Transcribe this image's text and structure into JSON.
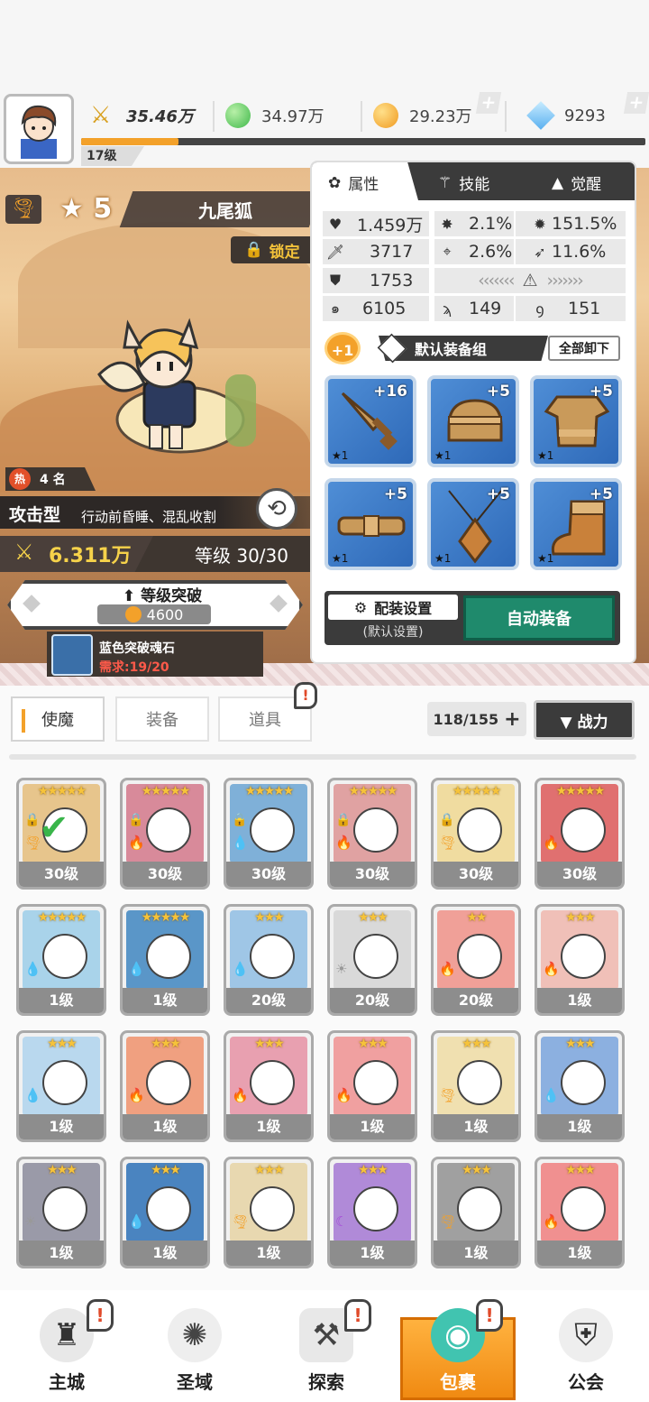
{
  "header": {
    "level": "17级",
    "power": "35.46万",
    "green_currency": "34.97万",
    "gold_currency": "29.23万",
    "diamond_currency": "9293"
  },
  "hero": {
    "stars": "5",
    "name": "九尾狐",
    "lock_label": "锁定",
    "hot_rank_label": "热",
    "hot_rank": "4 名",
    "type": "攻击型",
    "description": "行动前昏睡、混乱收割",
    "power": "6.311万",
    "level_text": "等级 30/30",
    "break_title": "等级突破",
    "break_cost": "4600",
    "stone_name": "蓝色突破魂石",
    "stone_requirement": "需求:19/20"
  },
  "panel": {
    "tabs": [
      {
        "label": "属性",
        "icon": "attribute-icon"
      },
      {
        "label": "技能",
        "icon": "skill-icon"
      },
      {
        "label": "觉醒",
        "icon": "awaken-icon"
      }
    ],
    "stats": {
      "hp": "1.459万",
      "crit": "2.1%",
      "crit_dmg": "151.5%",
      "atk": "3717",
      "hit": "2.6%",
      "speed_bonus": "11.6%",
      "def": "1753",
      "spd": "6105",
      "skill_a": "149",
      "skill_b": "151"
    },
    "equip_group_badge": "+1",
    "equip_group_name": "默认装备组",
    "unequip_all": "全部卸下",
    "slots": [
      {
        "item": "sword",
        "plus": "+16",
        "star": "★1"
      },
      {
        "item": "helmet",
        "plus": "+5",
        "star": "★1"
      },
      {
        "item": "armor",
        "plus": "+5",
        "star": "★1"
      },
      {
        "item": "belt",
        "plus": "+5",
        "star": "★1"
      },
      {
        "item": "necklace",
        "plus": "+5",
        "star": "★1"
      },
      {
        "item": "boots",
        "plus": "+5",
        "star": "★1"
      }
    ],
    "config_label": "配装设置",
    "config_sub": "(默认设置)",
    "auto_equip": "自动装备"
  },
  "list": {
    "tabs": [
      "使魔",
      "装备",
      "道具"
    ],
    "count": "118/155",
    "sort_label": "▼ 战力",
    "colors": {
      "accent": "#f3a12a",
      "auto_green": "#1f8a6c"
    }
  },
  "cards": [
    {
      "stars": "★★★★★",
      "level": "30级",
      "bg": "#e7c58c",
      "elem": "wind",
      "locked": true,
      "selected": true
    },
    {
      "stars": "★★★★★",
      "level": "30级",
      "bg": "#d88a9a",
      "elem": "fire",
      "locked": true
    },
    {
      "stars": "★★★★★",
      "level": "30级",
      "bg": "#7fb0d8",
      "elem": "water",
      "locked": true
    },
    {
      "stars": "★★★★★",
      "level": "30级",
      "bg": "#e0a2a2",
      "elem": "fire",
      "locked": true
    },
    {
      "stars": "★★★★★",
      "level": "30级",
      "bg": "#f0dca0",
      "elem": "wind",
      "locked": true
    },
    {
      "stars": "★★★★★",
      "level": "30级",
      "bg": "#e07070",
      "elem": "fire",
      "locked": false
    },
    {
      "stars": "★★★★★",
      "level": "1级",
      "bg": "#a9d3ea",
      "elem": "water"
    },
    {
      "stars": "★★★★★",
      "level": "1级",
      "bg": "#5a96c8",
      "elem": "water"
    },
    {
      "stars": "★★★",
      "level": "20级",
      "bg": "#9fc6e6",
      "elem": "water"
    },
    {
      "stars": "★★★",
      "level": "20级",
      "bg": "#d9d9d9",
      "elem": "light"
    },
    {
      "stars": "★★",
      "level": "20级",
      "bg": "#f0a098",
      "elem": "fire"
    },
    {
      "stars": "★★★",
      "level": "1级",
      "bg": "#f0c0b8",
      "elem": "fire"
    },
    {
      "stars": "★★★",
      "level": "1级",
      "bg": "#b9d8ee",
      "elem": "water"
    },
    {
      "stars": "★★★",
      "level": "1级",
      "bg": "#f0a080",
      "elem": "fire"
    },
    {
      "stars": "★★★",
      "level": "1级",
      "bg": "#e8a0b0",
      "elem": "fire"
    },
    {
      "stars": "★★★",
      "level": "1级",
      "bg": "#f0a0a0",
      "elem": "fire"
    },
    {
      "stars": "★★★",
      "level": "1级",
      "bg": "#f0e0b0",
      "elem": "wind"
    },
    {
      "stars": "★★★",
      "level": "1级",
      "bg": "#8cb0e0",
      "elem": "water"
    },
    {
      "stars": "★★★",
      "level": "1级",
      "bg": "#9a9aa8",
      "elem": "light"
    },
    {
      "stars": "★★★",
      "level": "1级",
      "bg": "#4a84c0",
      "elem": "water"
    },
    {
      "stars": "★★★",
      "level": "1级",
      "bg": "#e8d8b0",
      "elem": "wind"
    },
    {
      "stars": "★★★",
      "level": "1级",
      "bg": "#b08ad8",
      "elem": "dark"
    },
    {
      "stars": "★★★",
      "level": "1级",
      "bg": "#a0a0a0",
      "elem": "wind"
    },
    {
      "stars": "★★★",
      "level": "1级",
      "bg": "#f09090",
      "elem": "fire"
    }
  ],
  "nav": [
    {
      "label": "主城",
      "icon": "castle-icon",
      "badge": "!"
    },
    {
      "label": "圣域",
      "icon": "vortex-icon",
      "badge": ""
    },
    {
      "label": "探索",
      "icon": "sword-stone-icon",
      "badge": "!"
    },
    {
      "label": "包裹",
      "icon": "bag-icon",
      "badge": "!"
    },
    {
      "label": "公会",
      "icon": "guild-icon",
      "badge": ""
    }
  ]
}
